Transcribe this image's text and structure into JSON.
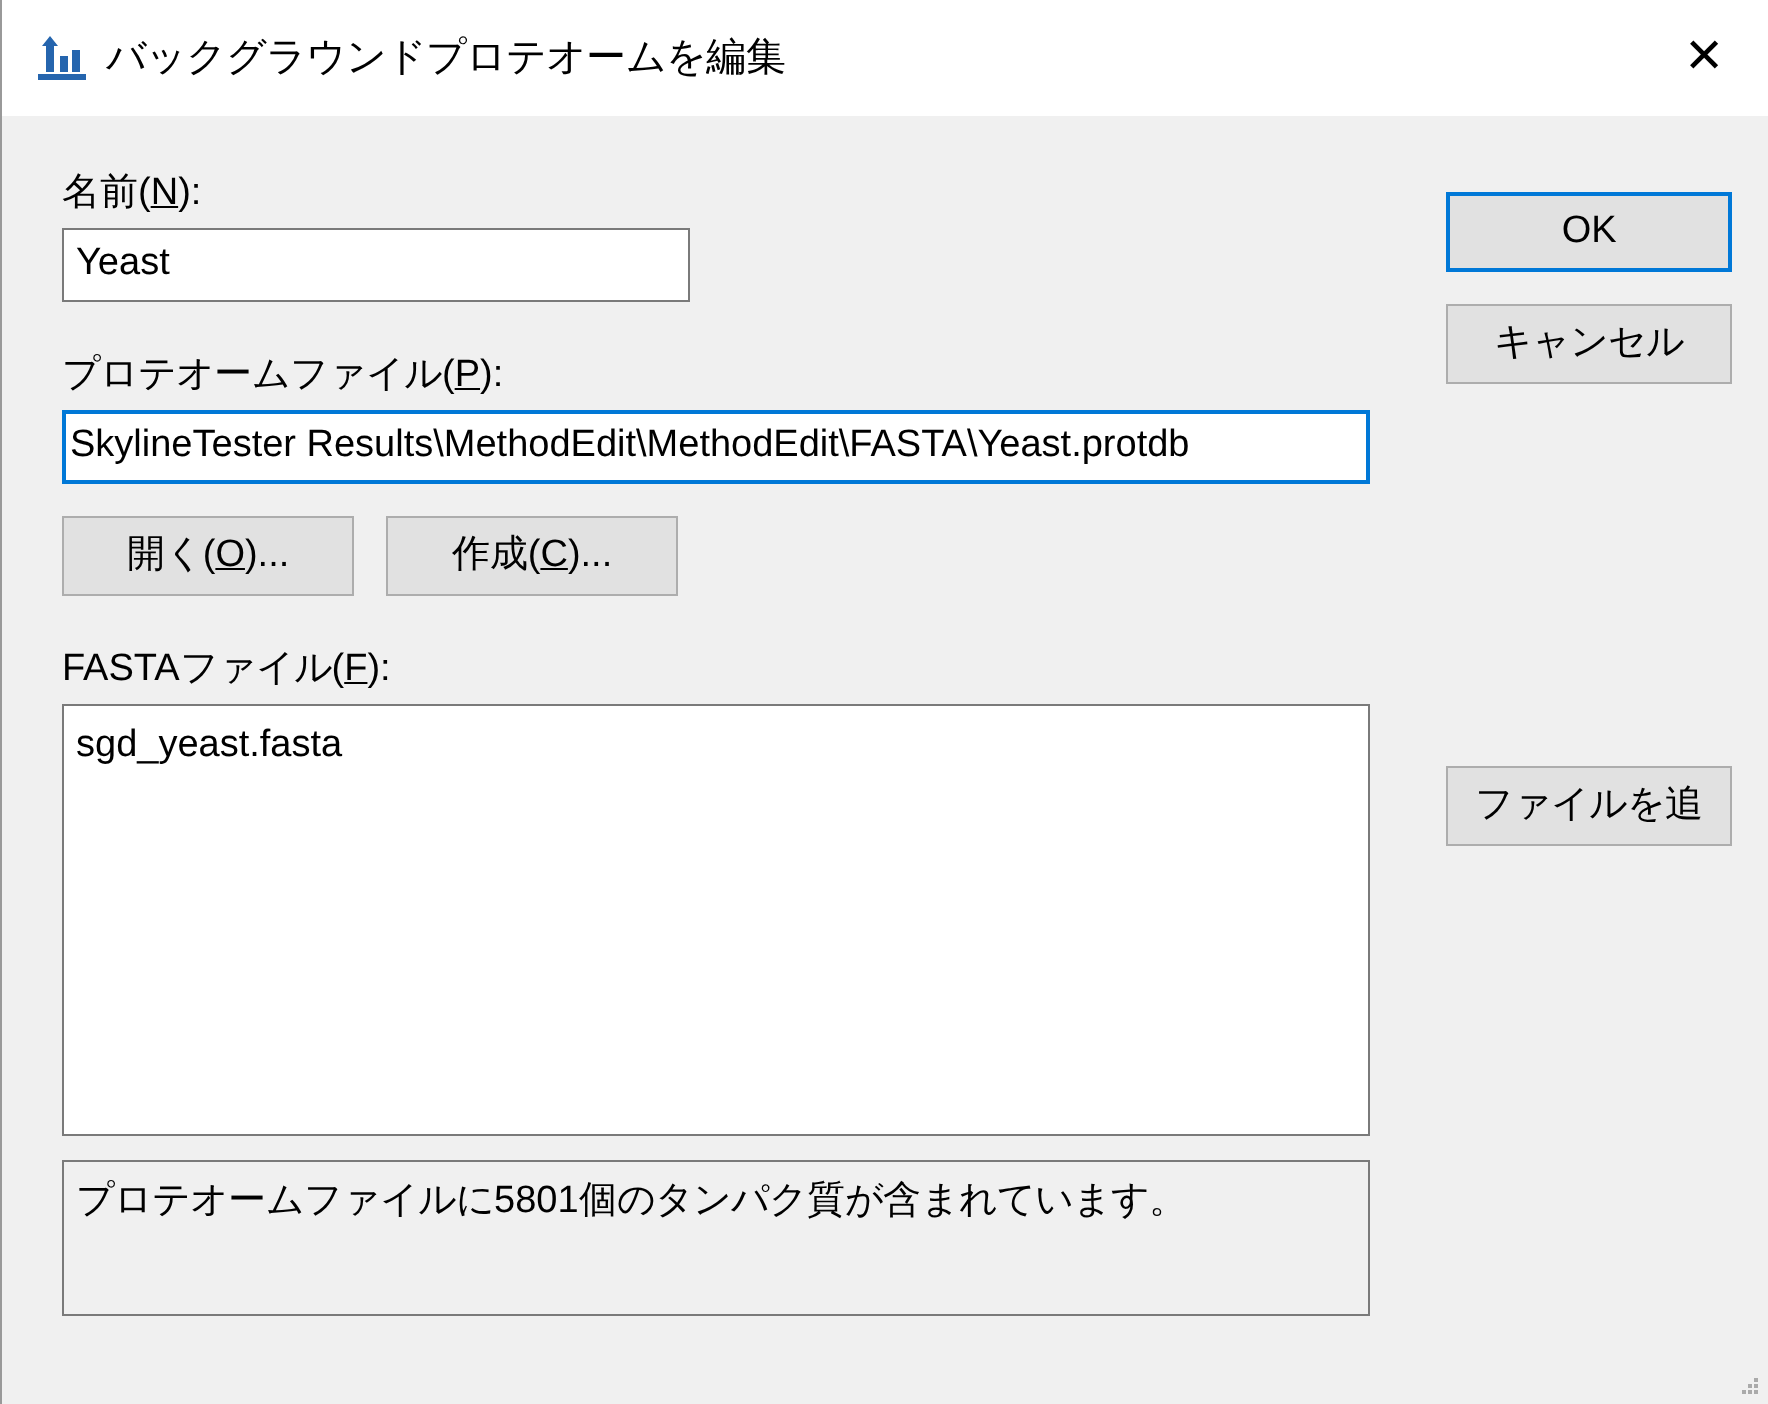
{
  "window": {
    "title": "バックグラウンドプロテオームを編集",
    "close": "✕"
  },
  "name": {
    "label": {
      "before": "名前(",
      "key": "N",
      "after": "):"
    },
    "value": "Yeast"
  },
  "proteome_file": {
    "label": {
      "before": "プロテオームファイル(",
      "key": "P",
      "after": "):"
    },
    "value": "SkylineTester Results\\MethodEdit\\MethodEdit\\FASTA\\Yeast.protdb",
    "focused": true
  },
  "file_buttons": [
    {
      "before": "開く(",
      "key": "O",
      "after": ")..."
    },
    {
      "before": "作成(",
      "key": "C",
      "after": ")..."
    }
  ],
  "fasta_files": {
    "label": {
      "before": "FASTAファイル(",
      "key": "F",
      "after": "):"
    },
    "items": [
      "sgd_yeast.fasta"
    ]
  },
  "status": "プロテオームファイルに5801個のタンパク質が含まれています。",
  "dialog_buttons": [
    {
      "label": "OK",
      "default": true
    },
    {
      "label": "キャンセル",
      "default": false
    }
  ],
  "add_file_button": "ファイルを追"
}
